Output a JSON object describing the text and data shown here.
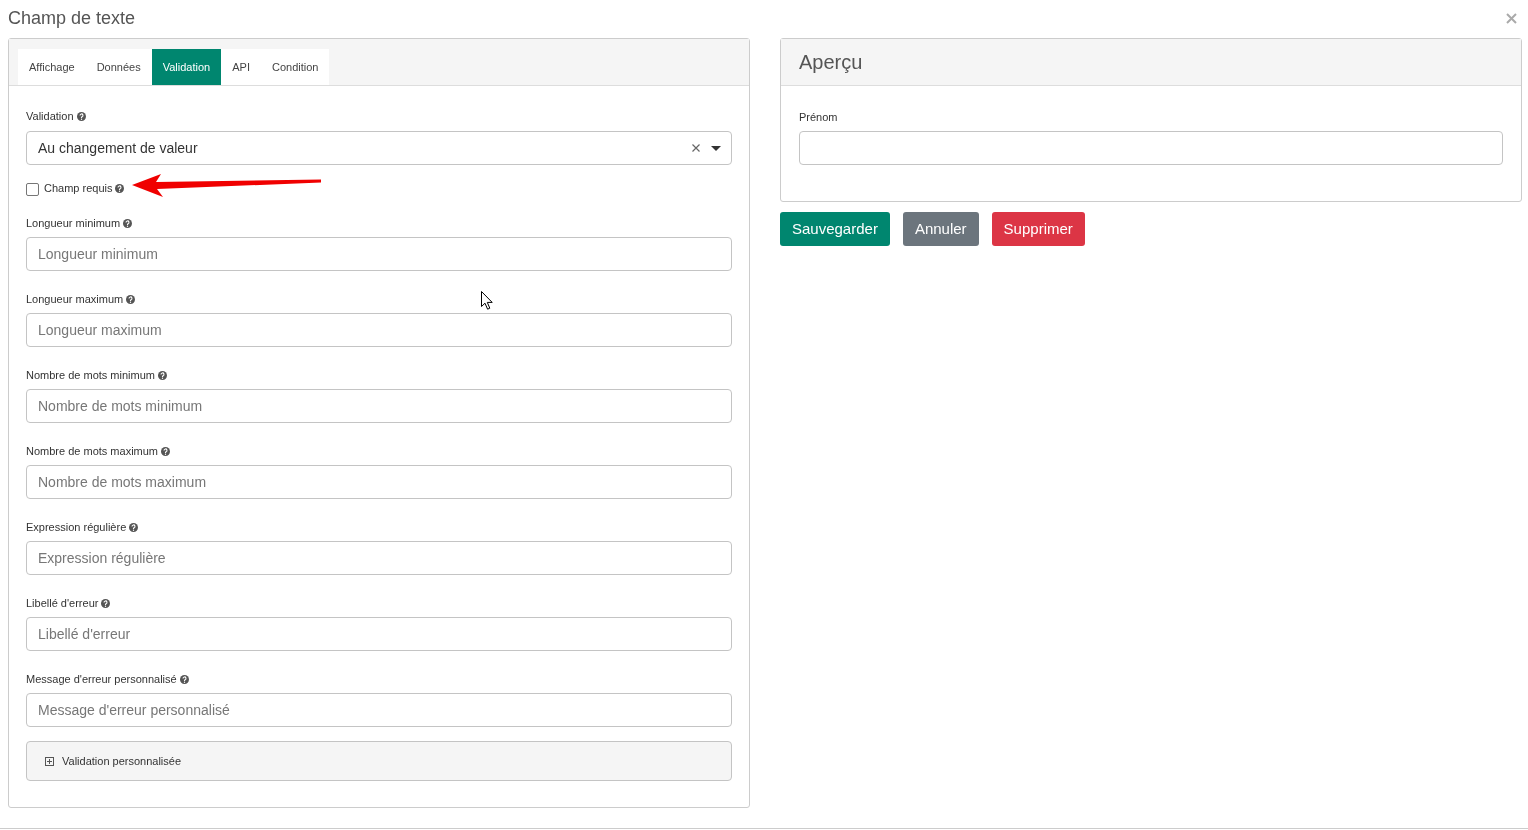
{
  "dialog": {
    "title": "Champ de texte"
  },
  "tabs": [
    {
      "label": "Affichage",
      "selected": false
    },
    {
      "label": "Données",
      "selected": false
    },
    {
      "label": "Validation",
      "selected": true
    },
    {
      "label": "API",
      "selected": false
    },
    {
      "label": "Condition",
      "selected": false
    }
  ],
  "validation_select": {
    "label": "Validation",
    "value": "Au changement de valeur"
  },
  "required_checkbox": {
    "label": "Champ requis",
    "checked": false
  },
  "fields": [
    {
      "label": "Longueur minimum",
      "placeholder": "Longueur minimum"
    },
    {
      "label": "Longueur maximum",
      "placeholder": "Longueur maximum"
    },
    {
      "label": "Nombre de mots minimum",
      "placeholder": "Nombre de mots minimum"
    },
    {
      "label": "Nombre de mots maximum",
      "placeholder": "Nombre de mots maximum"
    },
    {
      "label": "Expression régulière",
      "placeholder": "Expression régulière"
    },
    {
      "label": "Libellé d'erreur",
      "placeholder": "Libellé d'erreur"
    },
    {
      "label": "Message d'erreur personnalisé",
      "placeholder": "Message d'erreur personnalisé"
    }
  ],
  "collapsible": {
    "label": "Validation personnalisée",
    "expanded": false
  },
  "preview": {
    "title": "Aperçu",
    "field": {
      "label": "Prénom"
    }
  },
  "buttons": [
    {
      "label": "Sauvegarder",
      "kind": "primary"
    },
    {
      "label": "Annuler",
      "kind": "secondary"
    },
    {
      "label": "Supprimer",
      "kind": "danger"
    }
  ]
}
